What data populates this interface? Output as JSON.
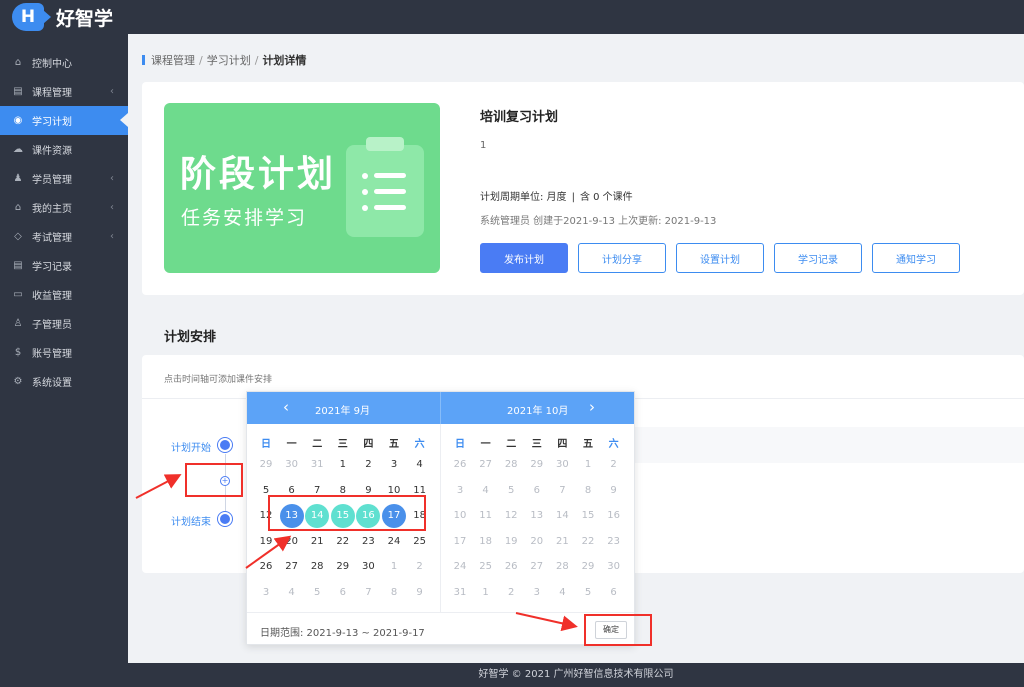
{
  "app": {
    "logo_letter": "H",
    "name": "好智学"
  },
  "sidebar": {
    "items": [
      {
        "label": "控制中心",
        "icon": "home-icon",
        "glyph": "⌂",
        "chevron": false,
        "active": false
      },
      {
        "label": "课程管理",
        "icon": "book-icon",
        "glyph": "▤",
        "chevron": true,
        "active": false
      },
      {
        "label": "学习计划",
        "icon": "eye-icon",
        "glyph": "◉",
        "chevron": false,
        "active": true
      },
      {
        "label": "课件资源",
        "icon": "cloud-icon",
        "glyph": "☁",
        "chevron": false,
        "active": false
      },
      {
        "label": "学员管理",
        "icon": "users-icon",
        "glyph": "♟",
        "chevron": true,
        "active": false
      },
      {
        "label": "我的主页",
        "icon": "graduation-cap-icon",
        "glyph": "⌂",
        "chevron": true,
        "active": false
      },
      {
        "label": "考试管理",
        "icon": "tag-icon",
        "glyph": "◇",
        "chevron": true,
        "active": false
      },
      {
        "label": "学习记录",
        "icon": "notebook-icon",
        "glyph": "▤",
        "chevron": false,
        "active": false
      },
      {
        "label": "收益管理",
        "icon": "card-icon",
        "glyph": "▭",
        "chevron": false,
        "active": false
      },
      {
        "label": "子管理员",
        "icon": "user-icon",
        "glyph": "♙",
        "chevron": false,
        "active": false
      },
      {
        "label": "账号管理",
        "icon": "dollar-icon",
        "glyph": "$",
        "chevron": false,
        "active": false
      },
      {
        "label": "系统设置",
        "icon": "gear-icon",
        "glyph": "⚙",
        "chevron": false,
        "active": false
      }
    ],
    "chevron_glyph": "‹"
  },
  "breadcrumb": {
    "items": [
      "课程管理",
      "学习计划"
    ],
    "current": "计划详情",
    "separator": "/"
  },
  "plan": {
    "banner_title": "阶段计划",
    "banner_subtitle": "任务安排学习",
    "title": "培训复习计划",
    "description": "1",
    "meta_unit": "计划周期单位: 月度",
    "meta_count": "含 0 个课件",
    "info": "系统管理员 创建于2021-9-13 上次更新: 2021-9-13",
    "buttons": [
      "发布计划",
      "计划分享",
      "设置计划",
      "学习记录",
      "通知学习"
    ]
  },
  "schedule": {
    "title": "计划安排",
    "hint": "点击时间轴可添加课件安排",
    "start_label": "计划开始",
    "end_label": "计划结束",
    "add_glyph": "+"
  },
  "datepicker": {
    "left_month": "2021年  9月",
    "right_month": "2021年  10月",
    "prev_glyph": "‹",
    "next_glyph": "›",
    "weekdays": [
      "日",
      "一",
      "二",
      "三",
      "四",
      "五",
      "六"
    ],
    "left_days": [
      [
        "29",
        "30",
        "31",
        "1",
        "2",
        "3",
        "4"
      ],
      [
        "5",
        "6",
        "7",
        "8",
        "9",
        "10",
        "11"
      ],
      [
        "12",
        "13",
        "14",
        "15",
        "16",
        "17",
        "18"
      ],
      [
        "19",
        "20",
        "21",
        "22",
        "23",
        "24",
        "25"
      ],
      [
        "26",
        "27",
        "28",
        "29",
        "30",
        "1",
        "2"
      ],
      [
        "3",
        "4",
        "5",
        "6",
        "7",
        "8",
        "9"
      ]
    ],
    "right_days": [
      [
        "26",
        "27",
        "28",
        "29",
        "30",
        "1",
        "2"
      ],
      [
        "3",
        "4",
        "5",
        "6",
        "7",
        "8",
        "9"
      ],
      [
        "10",
        "11",
        "12",
        "13",
        "14",
        "15",
        "16"
      ],
      [
        "17",
        "18",
        "19",
        "20",
        "21",
        "22",
        "23"
      ],
      [
        "24",
        "25",
        "26",
        "27",
        "28",
        "29",
        "30"
      ],
      [
        "31",
        "1",
        "2",
        "3",
        "4",
        "5",
        "6"
      ]
    ],
    "range_label": "日期范围: 2021-9-13 ~ 2021-9-17",
    "confirm_label": "确定",
    "colors": {
      "range_edge": "#4a90ea",
      "range_mid": "#5fe0d0",
      "header": "#5ca3f7"
    }
  },
  "footer": {
    "text": "好智学 © 2021 广州好智信息技术有限公司"
  }
}
